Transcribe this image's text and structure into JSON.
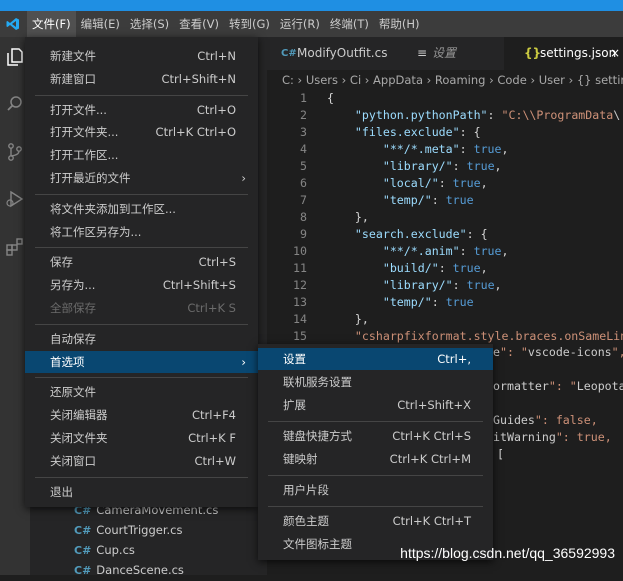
{
  "menubar": {
    "items": [
      "文件(F)",
      "编辑(E)",
      "选择(S)",
      "查看(V)",
      "转到(G)",
      "运行(R)",
      "终端(T)",
      "帮助(H)"
    ]
  },
  "activity_icons": [
    "explorer-icon",
    "search-icon",
    "source-control-icon",
    "run-debug-icon",
    "extensions-icon"
  ],
  "tabs": [
    {
      "icon": "C#",
      "label": "ModifyOutfit.cs"
    },
    {
      "icon": "≡",
      "label": "设置"
    },
    {
      "icon": "{}",
      "label": "settings.json",
      "close": "×"
    }
  ],
  "breadcrumb": "C: › Users › Ci › AppData › Roaming › Code › User › {} setting",
  "code_lines": [
    {
      "n": "1",
      "t": "{"
    },
    {
      "n": "2",
      "t": "    \"python.pythonPath\": \"C:\\\\ProgramData\\"
    },
    {
      "n": "3",
      "t": "    \"files.exclude\": {"
    },
    {
      "n": "4",
      "t": "        \"**/*.meta\": true,"
    },
    {
      "n": "5",
      "t": "        \"library/\": true,"
    },
    {
      "n": "6",
      "t": "        \"local/\": true,"
    },
    {
      "n": "7",
      "t": "        \"temp/\": true"
    },
    {
      "n": "8",
      "t": "    },"
    },
    {
      "n": "9",
      "t": "    \"search.exclude\": {"
    },
    {
      "n": "10",
      "t": "        \"**/*.anim\": true,"
    },
    {
      "n": "11",
      "t": "        \"build/\": true,"
    },
    {
      "n": "12",
      "t": "        \"library/\": true,"
    },
    {
      "n": "13",
      "t": "        \"temp/\": true"
    },
    {
      "n": "14",
      "t": "    },"
    },
    {
      "n": "15",
      "t": "    \"csharpfixformat.style.braces.onSameLin"
    }
  ],
  "code_fragments": [
    {
      "t": "e\": \"vscode-icons\","
    },
    {
      "t": "ormatter\": \"Leopota"
    },
    {
      "t": "Guides\": false,"
    },
    {
      "t": "itWarning\": true,"
    },
    {
      "t": "["
    }
  ],
  "file_menu": {
    "items": [
      {
        "label": "新建文件",
        "shortcut": "Ctrl+N"
      },
      {
        "label": "新建窗口",
        "shortcut": "Ctrl+Shift+N"
      },
      {
        "sep": true
      },
      {
        "label": "打开文件...",
        "shortcut": "Ctrl+O"
      },
      {
        "label": "打开文件夹...",
        "shortcut": "Ctrl+K Ctrl+O"
      },
      {
        "label": "打开工作区..."
      },
      {
        "label": "打开最近的文件",
        "arrow": "›"
      },
      {
        "sep": true
      },
      {
        "label": "将文件夹添加到工作区..."
      },
      {
        "label": "将工作区另存为..."
      },
      {
        "sep": true
      },
      {
        "label": "保存",
        "shortcut": "Ctrl+S"
      },
      {
        "label": "另存为...",
        "shortcut": "Ctrl+Shift+S"
      },
      {
        "label": "全部保存",
        "shortcut": "Ctrl+K S",
        "disabled": true
      },
      {
        "sep": true
      },
      {
        "label": "自动保存"
      },
      {
        "label": "首选项",
        "arrow": "›",
        "highlight": true
      },
      {
        "sep": true
      },
      {
        "label": "还原文件"
      },
      {
        "label": "关闭编辑器",
        "shortcut": "Ctrl+F4"
      },
      {
        "label": "关闭文件夹",
        "shortcut": "Ctrl+K F"
      },
      {
        "label": "关闭窗口",
        "shortcut": "Ctrl+W"
      },
      {
        "sep": true
      },
      {
        "label": "退出"
      }
    ]
  },
  "preferences_menu": {
    "items": [
      {
        "label": "设置",
        "shortcut": "Ctrl+,",
        "highlight": true
      },
      {
        "label": "联机服务设置"
      },
      {
        "label": "扩展",
        "shortcut": "Ctrl+Shift+X"
      },
      {
        "sep": true
      },
      {
        "label": "键盘快捷方式",
        "shortcut": "Ctrl+K Ctrl+S"
      },
      {
        "label": "键映射",
        "shortcut": "Ctrl+K Ctrl+M"
      },
      {
        "sep": true
      },
      {
        "label": "用户片段"
      },
      {
        "sep": true
      },
      {
        "label": "颜色主题",
        "shortcut": "Ctrl+K Ctrl+T"
      },
      {
        "label": "文件图标主题"
      }
    ]
  },
  "explorer_files": [
    {
      "icon": "C#",
      "name": "CameraMovement.cs"
    },
    {
      "icon": "C#",
      "name": "CourtTrigger.cs"
    },
    {
      "icon": "C#",
      "name": "Cup.cs"
    },
    {
      "icon": "C#",
      "name": "DanceScene.cs"
    }
  ],
  "watermark": "https://blog.csdn.net/qq_36592993",
  "colors": {
    "accent": "#1f8fe3",
    "highlight": "#094771",
    "menu_bg": "#252526"
  }
}
